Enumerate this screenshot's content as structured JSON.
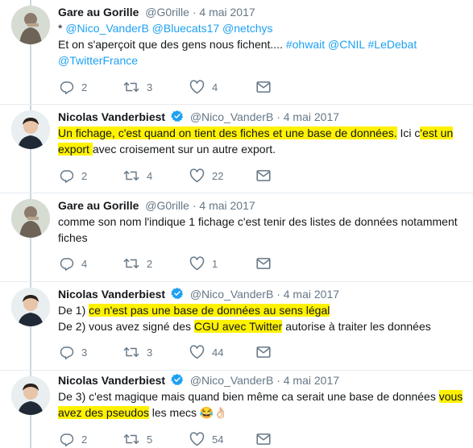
{
  "tweets": [
    {
      "author": "Gare au Gorille",
      "handle": "@G0rille",
      "sep": "·",
      "date": "4 mai 2017",
      "verified": false,
      "line1": {
        "star": "* ",
        "mentions": "@Nico_VanderB @Bluecats17 @netchys"
      },
      "line2": {
        "text": "Et on s'aperçoit que des gens nous fichent.... ",
        "tag1": "#ohwait",
        "space1": " ",
        "tag2": "@CNIL",
        "space2": " ",
        "tag3": "#LeDebat"
      },
      "line3": {
        "mention": "@TwitterFrance"
      },
      "replies": "2",
      "retweets": "3",
      "likes": "4"
    },
    {
      "author": "Nicolas Vanderbiest",
      "handle": "@Nico_VanderB",
      "sep": "·",
      "date": "4 mai 2017",
      "verified": true,
      "line1": {
        "hl1": "Un fichage, c'est quand on tient des fiches et une base de données.",
        "plain1": " Ici c",
        "hl2": "'est un"
      },
      "line2": {
        "hl1": "export ",
        "plain1": "avec croisement sur un autre export."
      },
      "replies": "2",
      "retweets": "4",
      "likes": "22"
    },
    {
      "author": "Gare au Gorille",
      "handle": "@G0rille",
      "sep": "·",
      "date": "4 mai 2017",
      "verified": false,
      "line1": {
        "text": "comme son nom l'indique 1 fichage c'est tenir des listes de données notamment"
      },
      "line2": {
        "text": "fiches"
      },
      "replies": "4",
      "retweets": "2",
      "likes": "1"
    },
    {
      "author": "Nicolas Vanderbiest",
      "handle": "@Nico_VanderB",
      "sep": "·",
      "date": "4 mai 2017",
      "verified": true,
      "line1": {
        "plain1": "De 1) ",
        "hl1": "ce n'est pas une base de données au sens légal"
      },
      "line2": {
        "plain1": "De 2) vous avez signé des ",
        "hl1": "CGU avec Twitter",
        "plain2": " autorise à traiter les données"
      },
      "replies": "3",
      "retweets": "3",
      "likes": "44"
    },
    {
      "author": "Nicolas Vanderbiest",
      "handle": "@Nico_VanderB",
      "sep": "·",
      "date": "4 mai 2017",
      "verified": true,
      "line1": {
        "plain1": "De 3) c'est magique mais quand bien même ca serait une base de données ",
        "hl1": "vous"
      },
      "line2": {
        "hl1": "avez des pseudos",
        "plain1": " les mecs ",
        "emoji1": "😂",
        "emoji2": "👌🏻"
      },
      "replies": "2",
      "retweets": "5",
      "likes": "54"
    }
  ],
  "icons": {
    "reply": "reply-icon",
    "retweet": "retweet-icon",
    "like": "heart-icon",
    "dm": "envelope-icon",
    "verified": "verified-badge-icon"
  },
  "colors": {
    "link": "#1da1f2",
    "highlight": "#fff200",
    "muted": "#657786",
    "verified": "#1da1f2"
  }
}
